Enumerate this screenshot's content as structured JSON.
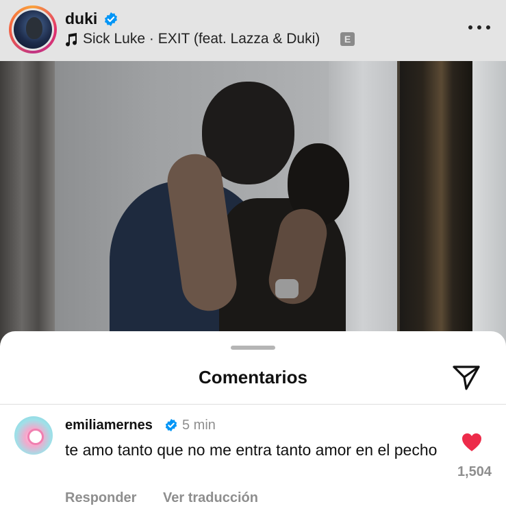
{
  "post_header": {
    "username": "duki",
    "song": "Sick Luke · EXIT (feat. Lazza & Duki)",
    "explicit_badge": "E",
    "avatar_icon": "profile-avatar"
  },
  "comments_sheet": {
    "title": "Comentarios",
    "share_icon": "send-icon"
  },
  "comments": [
    {
      "username": "emiliamernes",
      "verified": true,
      "time": "5 min",
      "text": "te amo tanto que no me entra tanto amor en el pecho",
      "likes": "1,504",
      "liked": true,
      "reply_label": "Responder",
      "translate_label": "Ver traducción"
    }
  ],
  "colors": {
    "verified_blue": "#0095f6",
    "like_red": "#ed2b4a",
    "muted_text": "#8e8e8e"
  }
}
